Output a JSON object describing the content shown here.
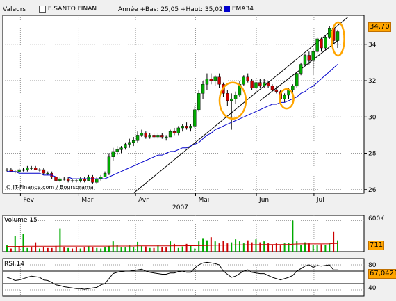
{
  "header": {
    "valeurs_label": "Valeurs",
    "name": "E.SANTO FINAN",
    "range": "Année +Bas: 25,05 +Haut: 35,02",
    "ema_label": "EMA34",
    "ema_color": "#0000cc",
    "credit": "© IT-Finance.com / Boursorama"
  },
  "colors": {
    "up": "#00aa00",
    "down": "#cc0000",
    "highlight": "#ffa500",
    "grid": "#9a9a9a"
  },
  "chart_data": [
    {
      "type": "candlestick",
      "title": "E.SANTO FINAN",
      "x_ticks": [
        "Fev",
        "Mar",
        "Avr",
        "Mai",
        "Jun",
        "Jul"
      ],
      "x_year": "2007",
      "y_ticks": [
        "26",
        "28",
        "30",
        "32",
        "34"
      ],
      "ylim": [
        25.8,
        35.6
      ],
      "last_value": "34,70",
      "grid": true,
      "ohlc": [
        [
          27.1,
          27.2,
          27.0,
          27.1
        ],
        [
          27.1,
          27.2,
          27.0,
          27.0
        ],
        [
          27.0,
          27.1,
          26.9,
          27.0
        ],
        [
          27.0,
          27.2,
          26.9,
          27.1
        ],
        [
          27.1,
          27.2,
          27.0,
          27.1
        ],
        [
          27.1,
          27.3,
          27.0,
          27.2
        ],
        [
          27.2,
          27.3,
          27.1,
          27.2
        ],
        [
          27.2,
          27.3,
          27.1,
          27.1
        ],
        [
          27.1,
          27.2,
          27.0,
          27.1
        ],
        [
          27.1,
          27.2,
          26.8,
          26.9
        ],
        [
          26.9,
          27.0,
          26.8,
          26.9
        ],
        [
          26.9,
          27.0,
          26.6,
          26.7
        ],
        [
          26.7,
          26.8,
          26.4,
          26.5
        ],
        [
          26.5,
          26.7,
          26.4,
          26.6
        ],
        [
          26.6,
          26.7,
          26.5,
          26.6
        ],
        [
          26.6,
          26.7,
          26.4,
          26.5
        ],
        [
          26.5,
          26.6,
          26.4,
          26.5
        ],
        [
          26.5,
          26.6,
          26.4,
          26.5
        ],
        [
          26.5,
          26.7,
          26.4,
          26.6
        ],
        [
          26.6,
          26.7,
          26.4,
          26.5
        ],
        [
          26.5,
          26.8,
          26.5,
          26.7
        ],
        [
          26.7,
          26.8,
          26.3,
          26.4
        ],
        [
          26.4,
          26.7,
          26.3,
          26.6
        ],
        [
          26.6,
          26.8,
          26.5,
          26.7
        ],
        [
          26.7,
          27.0,
          26.7,
          26.9
        ],
        [
          26.9,
          28.0,
          26.8,
          27.8
        ],
        [
          27.8,
          28.3,
          27.6,
          28.1
        ],
        [
          28.1,
          28.4,
          27.9,
          28.2
        ],
        [
          28.2,
          28.4,
          28.0,
          28.3
        ],
        [
          28.3,
          28.6,
          28.2,
          28.5
        ],
        [
          28.5,
          28.8,
          28.3,
          28.6
        ],
        [
          28.6,
          28.9,
          28.4,
          28.7
        ],
        [
          28.7,
          29.2,
          28.6,
          29.0
        ],
        [
          29.0,
          29.3,
          28.9,
          29.1
        ],
        [
          29.1,
          29.2,
          28.8,
          28.9
        ],
        [
          28.9,
          29.1,
          28.8,
          29.0
        ],
        [
          29.0,
          29.1,
          28.8,
          28.9
        ],
        [
          28.9,
          29.1,
          28.8,
          29.0
        ],
        [
          29.0,
          29.1,
          28.8,
          28.9
        ],
        [
          28.9,
          29.0,
          28.7,
          28.9
        ],
        [
          28.9,
          29.3,
          28.9,
          29.2
        ],
        [
          29.2,
          29.4,
          29.0,
          29.1
        ],
        [
          29.1,
          29.5,
          29.0,
          29.4
        ],
        [
          29.4,
          29.6,
          29.2,
          29.5
        ],
        [
          29.5,
          29.7,
          29.3,
          29.4
        ],
        [
          29.4,
          29.6,
          29.2,
          29.5
        ],
        [
          29.5,
          30.6,
          29.4,
          30.4
        ],
        [
          30.4,
          31.5,
          30.3,
          31.3
        ],
        [
          31.3,
          32.0,
          31.0,
          31.8
        ],
        [
          31.8,
          32.4,
          31.5,
          32.1
        ],
        [
          32.1,
          32.4,
          31.8,
          32.0
        ],
        [
          32.0,
          32.3,
          31.7,
          32.2
        ],
        [
          32.2,
          32.4,
          31.6,
          31.8
        ],
        [
          31.8,
          31.9,
          31.1,
          31.3
        ],
        [
          31.3,
          31.5,
          30.6,
          30.9
        ],
        [
          30.9,
          31.3,
          29.3,
          31.0
        ],
        [
          31.0,
          31.4,
          30.7,
          31.2
        ],
        [
          31.2,
          32.0,
          31.1,
          31.8
        ],
        [
          31.8,
          32.3,
          31.7,
          32.2
        ],
        [
          32.2,
          32.4,
          31.9,
          32.0
        ],
        [
          32.0,
          32.1,
          31.5,
          31.6
        ],
        [
          31.6,
          32.0,
          31.5,
          31.9
        ],
        [
          31.9,
          32.1,
          31.6,
          31.7
        ],
        [
          31.7,
          32.1,
          31.6,
          31.9
        ],
        [
          31.9,
          32.0,
          31.6,
          31.7
        ],
        [
          31.7,
          31.8,
          31.4,
          31.5
        ],
        [
          31.5,
          31.7,
          31.3,
          31.4
        ],
        [
          31.4,
          31.5,
          30.9,
          31.0
        ],
        [
          31.0,
          31.3,
          30.8,
          31.2
        ],
        [
          31.2,
          31.6,
          31.0,
          31.5
        ],
        [
          31.5,
          31.8,
          31.3,
          31.7
        ],
        [
          31.7,
          32.5,
          31.6,
          32.4
        ],
        [
          32.4,
          33.0,
          32.3,
          32.9
        ],
        [
          32.9,
          33.5,
          32.8,
          33.4
        ],
        [
          33.4,
          33.6,
          32.9,
          33.1
        ],
        [
          33.1,
          33.8,
          32.3,
          33.6
        ],
        [
          33.6,
          34.4,
          33.5,
          34.3
        ],
        [
          34.3,
          34.4,
          33.6,
          33.8
        ],
        [
          33.8,
          34.5,
          33.7,
          34.4
        ],
        [
          34.4,
          35.0,
          34.3,
          34.9
        ],
        [
          34.9,
          35.0,
          34.0,
          34.2
        ],
        [
          34.2,
          34.8,
          33.8,
          34.7
        ]
      ],
      "ema34": [
        27.0,
        27.0,
        27.0,
        26.9,
        26.9,
        26.9,
        26.9,
        26.9,
        26.9,
        26.8,
        26.8,
        26.8,
        26.7,
        26.7,
        26.7,
        26.7,
        26.6,
        26.6,
        26.6,
        26.6,
        26.6,
        26.6,
        26.6,
        26.6,
        26.6,
        26.7,
        26.8,
        26.9,
        27.0,
        27.1,
        27.2,
        27.3,
        27.4,
        27.5,
        27.6,
        27.7,
        27.8,
        27.9,
        27.9,
        28.0,
        28.1,
        28.1,
        28.2,
        28.3,
        28.3,
        28.4,
        28.5,
        28.6,
        28.8,
        29.0,
        29.1,
        29.3,
        29.4,
        29.5,
        29.6,
        29.7,
        29.8,
        29.9,
        30.0,
        30.1,
        30.2,
        30.3,
        30.4,
        30.5,
        30.6,
        30.7,
        30.7,
        30.8,
        30.8,
        30.9,
        31.0,
        31.1,
        31.3,
        31.4,
        31.6,
        31.7,
        31.9,
        32.1,
        32.3,
        32.5,
        32.7,
        32.9
      ]
    },
    {
      "type": "bar",
      "title": "Volume 15",
      "y_ticks": [
        "600K"
      ],
      "last_value": "711",
      "values": [
        120,
        60,
        300,
        90,
        350,
        70,
        80,
        180,
        60,
        90,
        70,
        70,
        110,
        450,
        80,
        70,
        60,
        90,
        60,
        80,
        100,
        80,
        70,
        60,
        80,
        110,
        200,
        130,
        80,
        80,
        120,
        90,
        190,
        110,
        100,
        70,
        70,
        120,
        90,
        80,
        200,
        150,
        70,
        100,
        150,
        120,
        60,
        200,
        250,
        220,
        280,
        200,
        160,
        210,
        160,
        180,
        240,
        200,
        160,
        220,
        180,
        240,
        180,
        200,
        160,
        140,
        160,
        120,
        160,
        170,
        600,
        200,
        130,
        180,
        160,
        130,
        120,
        140,
        130,
        160,
        380,
        220
      ],
      "up": [
        true,
        false,
        true,
        false,
        true,
        true,
        false,
        false,
        true,
        false,
        false,
        false,
        false,
        true,
        false,
        true,
        false,
        false,
        true,
        false,
        true,
        false,
        true,
        true,
        true,
        true,
        true,
        true,
        true,
        true,
        true,
        true,
        true,
        true,
        false,
        true,
        false,
        true,
        false,
        false,
        true,
        false,
        true,
        true,
        false,
        true,
        true,
        true,
        true,
        true,
        false,
        true,
        false,
        false,
        false,
        true,
        true,
        true,
        true,
        false,
        false,
        true,
        false,
        true,
        false,
        false,
        false,
        false,
        true,
        true,
        true,
        true,
        true,
        true,
        false,
        true,
        true,
        false,
        true,
        true,
        false,
        true
      ],
      "avg_line": [
        100,
        100,
        100,
        101,
        102,
        103,
        103,
        104,
        104,
        104,
        104,
        104,
        104,
        106,
        106,
        106,
        106,
        106,
        106,
        106,
        106,
        106,
        106,
        106,
        106,
        106,
        108,
        108,
        108,
        108,
        108,
        108,
        110,
        110,
        110,
        110,
        110,
        110,
        110,
        110,
        112,
        113,
        113,
        113,
        114,
        114,
        114,
        116,
        118,
        120,
        122,
        124,
        125,
        126,
        127,
        128,
        130,
        131,
        132,
        133,
        134,
        135,
        136,
        137,
        137,
        137,
        137,
        137,
        137,
        138,
        146,
        148,
        149,
        150,
        150,
        150,
        150,
        150,
        150,
        151,
        157,
        158
      ]
    },
    {
      "type": "line",
      "title": "RSI 14",
      "y_ticks": [
        "80",
        "40"
      ],
      "ylim": [
        30,
        90
      ],
      "last_value": "67,0421",
      "values": [
        60,
        58,
        55,
        56,
        58,
        60,
        62,
        61,
        60,
        56,
        55,
        52,
        48,
        47,
        45,
        44,
        43,
        42,
        42,
        41,
        42,
        43,
        44,
        48,
        50,
        58,
        66,
        68,
        69,
        70,
        70,
        71,
        72,
        73,
        70,
        68,
        67,
        66,
        65,
        65,
        67,
        67,
        69,
        70,
        68,
        68,
        75,
        80,
        83,
        84,
        83,
        82,
        80,
        70,
        65,
        60,
        62,
        66,
        70,
        72,
        68,
        67,
        66,
        66,
        63,
        60,
        58,
        56,
        58,
        60,
        63,
        70,
        74,
        78,
        80,
        76,
        79,
        78,
        79,
        80,
        72,
        72
      ]
    }
  ]
}
